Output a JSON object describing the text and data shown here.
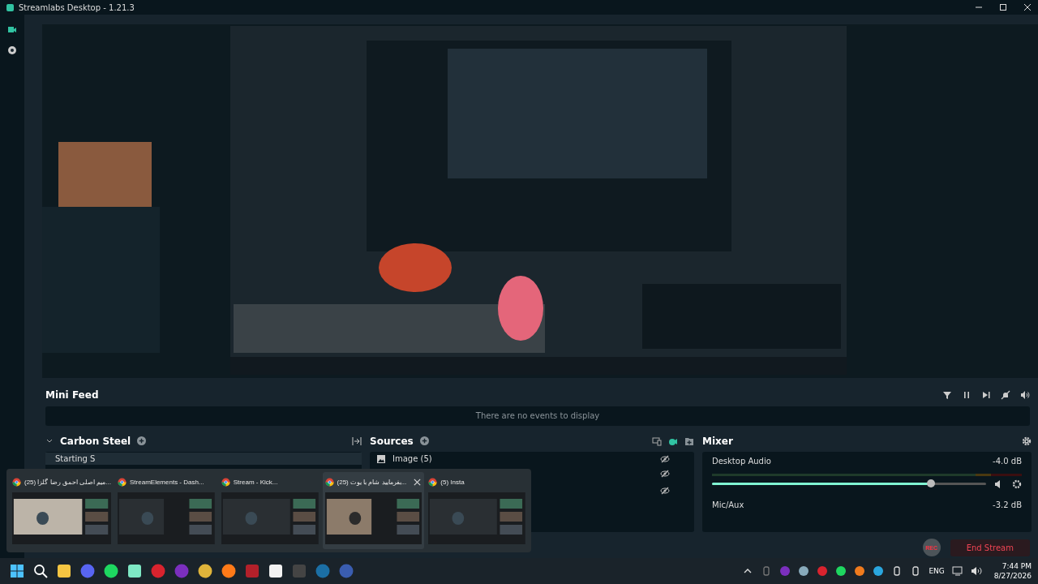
{
  "window": {
    "title": "Streamlabs Desktop - 1.21.3"
  },
  "mini_feed": {
    "title": "Mini Feed",
    "empty_message": "There are no events to display"
  },
  "scenes": {
    "title": "Carbon Steel",
    "items": [
      {
        "name": "Starting S",
        "selected": true
      }
    ]
  },
  "sources": {
    "title": "Sources",
    "items": [
      {
        "name": "Image (5)",
        "visible": false
      },
      {
        "visible": false
      },
      {
        "visible": false
      }
    ]
  },
  "mixer": {
    "title": "Mixer",
    "channels": [
      {
        "name": "Desktop Audio",
        "reading": "-4.0 dB",
        "level": 0.8
      },
      {
        "name": "Mic/Aux",
        "reading": "-3.2 dB"
      }
    ]
  },
  "stream": {
    "rec_label": "REC",
    "end_button": "End Stream"
  },
  "taskbar_previews": [
    {
      "title": "(25) میم اصلی احمق رضا گلزا...",
      "selected": false
    },
    {
      "title": "StreamElements - Dash...",
      "selected": false
    },
    {
      "title": "Stream - Kick...",
      "selected": false
    },
    {
      "title": "(25) بفرمایید شام با یوت...",
      "selected": true
    },
    {
      "title": "(5) Insta",
      "selected": false
    }
  ],
  "tray": {
    "language": "ENG",
    "time": "7:44 PM",
    "date": "8/27/2026"
  }
}
